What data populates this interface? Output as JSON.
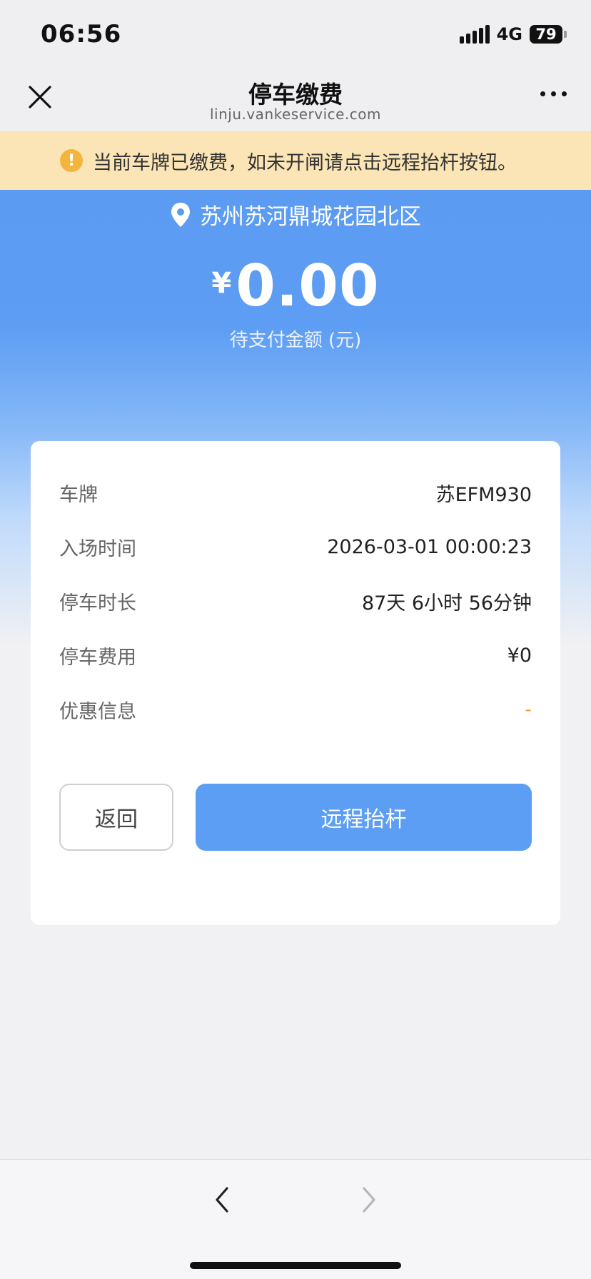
{
  "status_bar": {
    "time": "06:56",
    "network": "4G",
    "battery": "79"
  },
  "nav": {
    "title": "停车缴费",
    "url": "linju.vankeservice.com",
    "close_icon": "close-icon",
    "more_icon": "more-icon"
  },
  "notice": {
    "icon": "warning-icon",
    "text": "当前车牌已缴费，如未开闸请点击远程抬杆按钮。"
  },
  "hero": {
    "location": "苏州苏河鼎城花园北区",
    "currency": "¥",
    "amount": "0.00",
    "caption": "待支付金额 (元)"
  },
  "details": [
    {
      "label": "车牌",
      "value": "苏EFM930"
    },
    {
      "label": "入场时间",
      "value": "2026-03-01 00:00:23"
    },
    {
      "label": "停车时长",
      "value": "87天 6小时 56分钟"
    },
    {
      "label": "停车费用",
      "value": "¥0"
    },
    {
      "label": "优惠信息",
      "value": "-"
    }
  ],
  "buttons": {
    "back": "返回",
    "remote_lift": "远程抬杆"
  },
  "colors": {
    "primary": "#5b9ef3",
    "notice_bg": "#fbe4b5",
    "notice_icon": "#f3b53b",
    "accent_dash": "#f2a33a"
  }
}
